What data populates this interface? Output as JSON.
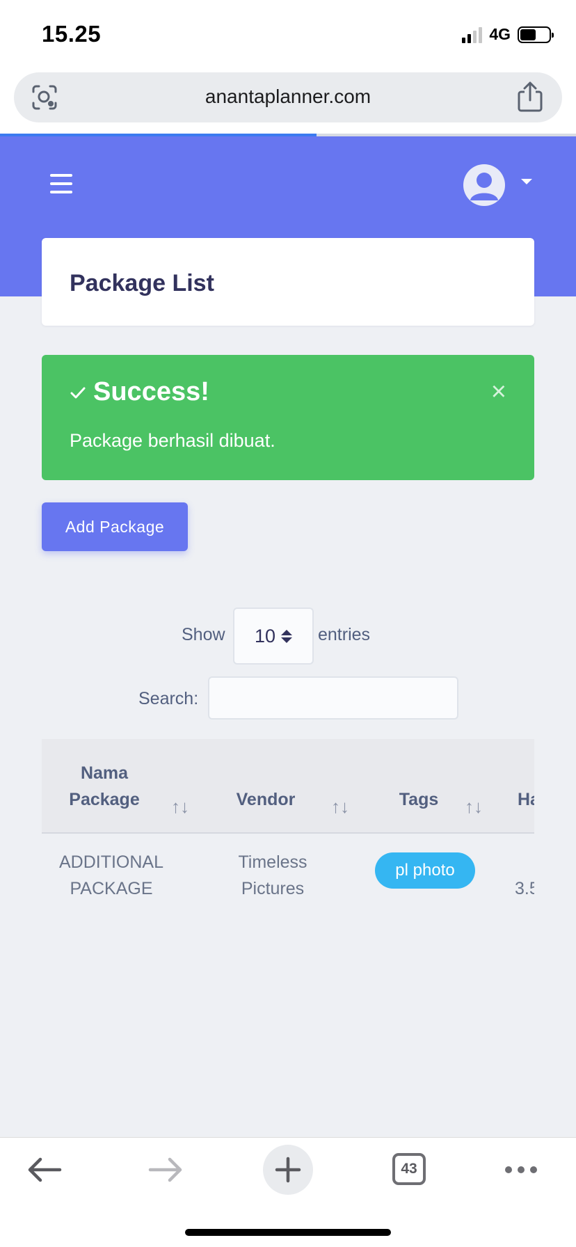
{
  "status_bar": {
    "time": "15.25",
    "network": "4G",
    "battery_percent": 55
  },
  "browser": {
    "url": "anantaplanner.com",
    "load_progress_percent": 55,
    "tab_count": "43"
  },
  "page": {
    "title": "Package List"
  },
  "alert": {
    "title": "Success!",
    "message": "Package berhasil dibuat.",
    "close_glyph": "×",
    "color": "#4bc364"
  },
  "actions": {
    "add_package_label": "Add Package"
  },
  "datatable": {
    "show_label": "Show",
    "entries_value": "10",
    "entries_label": "entries",
    "search_label": "Search:",
    "search_value": "",
    "columns": [
      {
        "label_line1": "Nama",
        "label_line2": "Package"
      },
      {
        "label": "Vendor"
      },
      {
        "label": "Tags"
      },
      {
        "label": "Ha"
      }
    ],
    "sort_glyph": "↑↓",
    "rows": [
      {
        "name_line1": "ADDITIONAL",
        "name_line2": "PACKAGE",
        "vendor_line1": "Timeless",
        "vendor_line2": "Pictures",
        "tag": "pl photo",
        "price": "3.5"
      }
    ]
  },
  "colors": {
    "brand": "#6776f0",
    "tag": "#35b6f2"
  },
  "icons": [
    "lens-icon",
    "share-icon",
    "menu-icon",
    "user-avatar-icon",
    "caret-down-icon",
    "check-icon",
    "close-icon",
    "back-arrow-icon",
    "forward-arrow-icon",
    "plus-icon",
    "tabs-icon",
    "more-icon"
  ]
}
